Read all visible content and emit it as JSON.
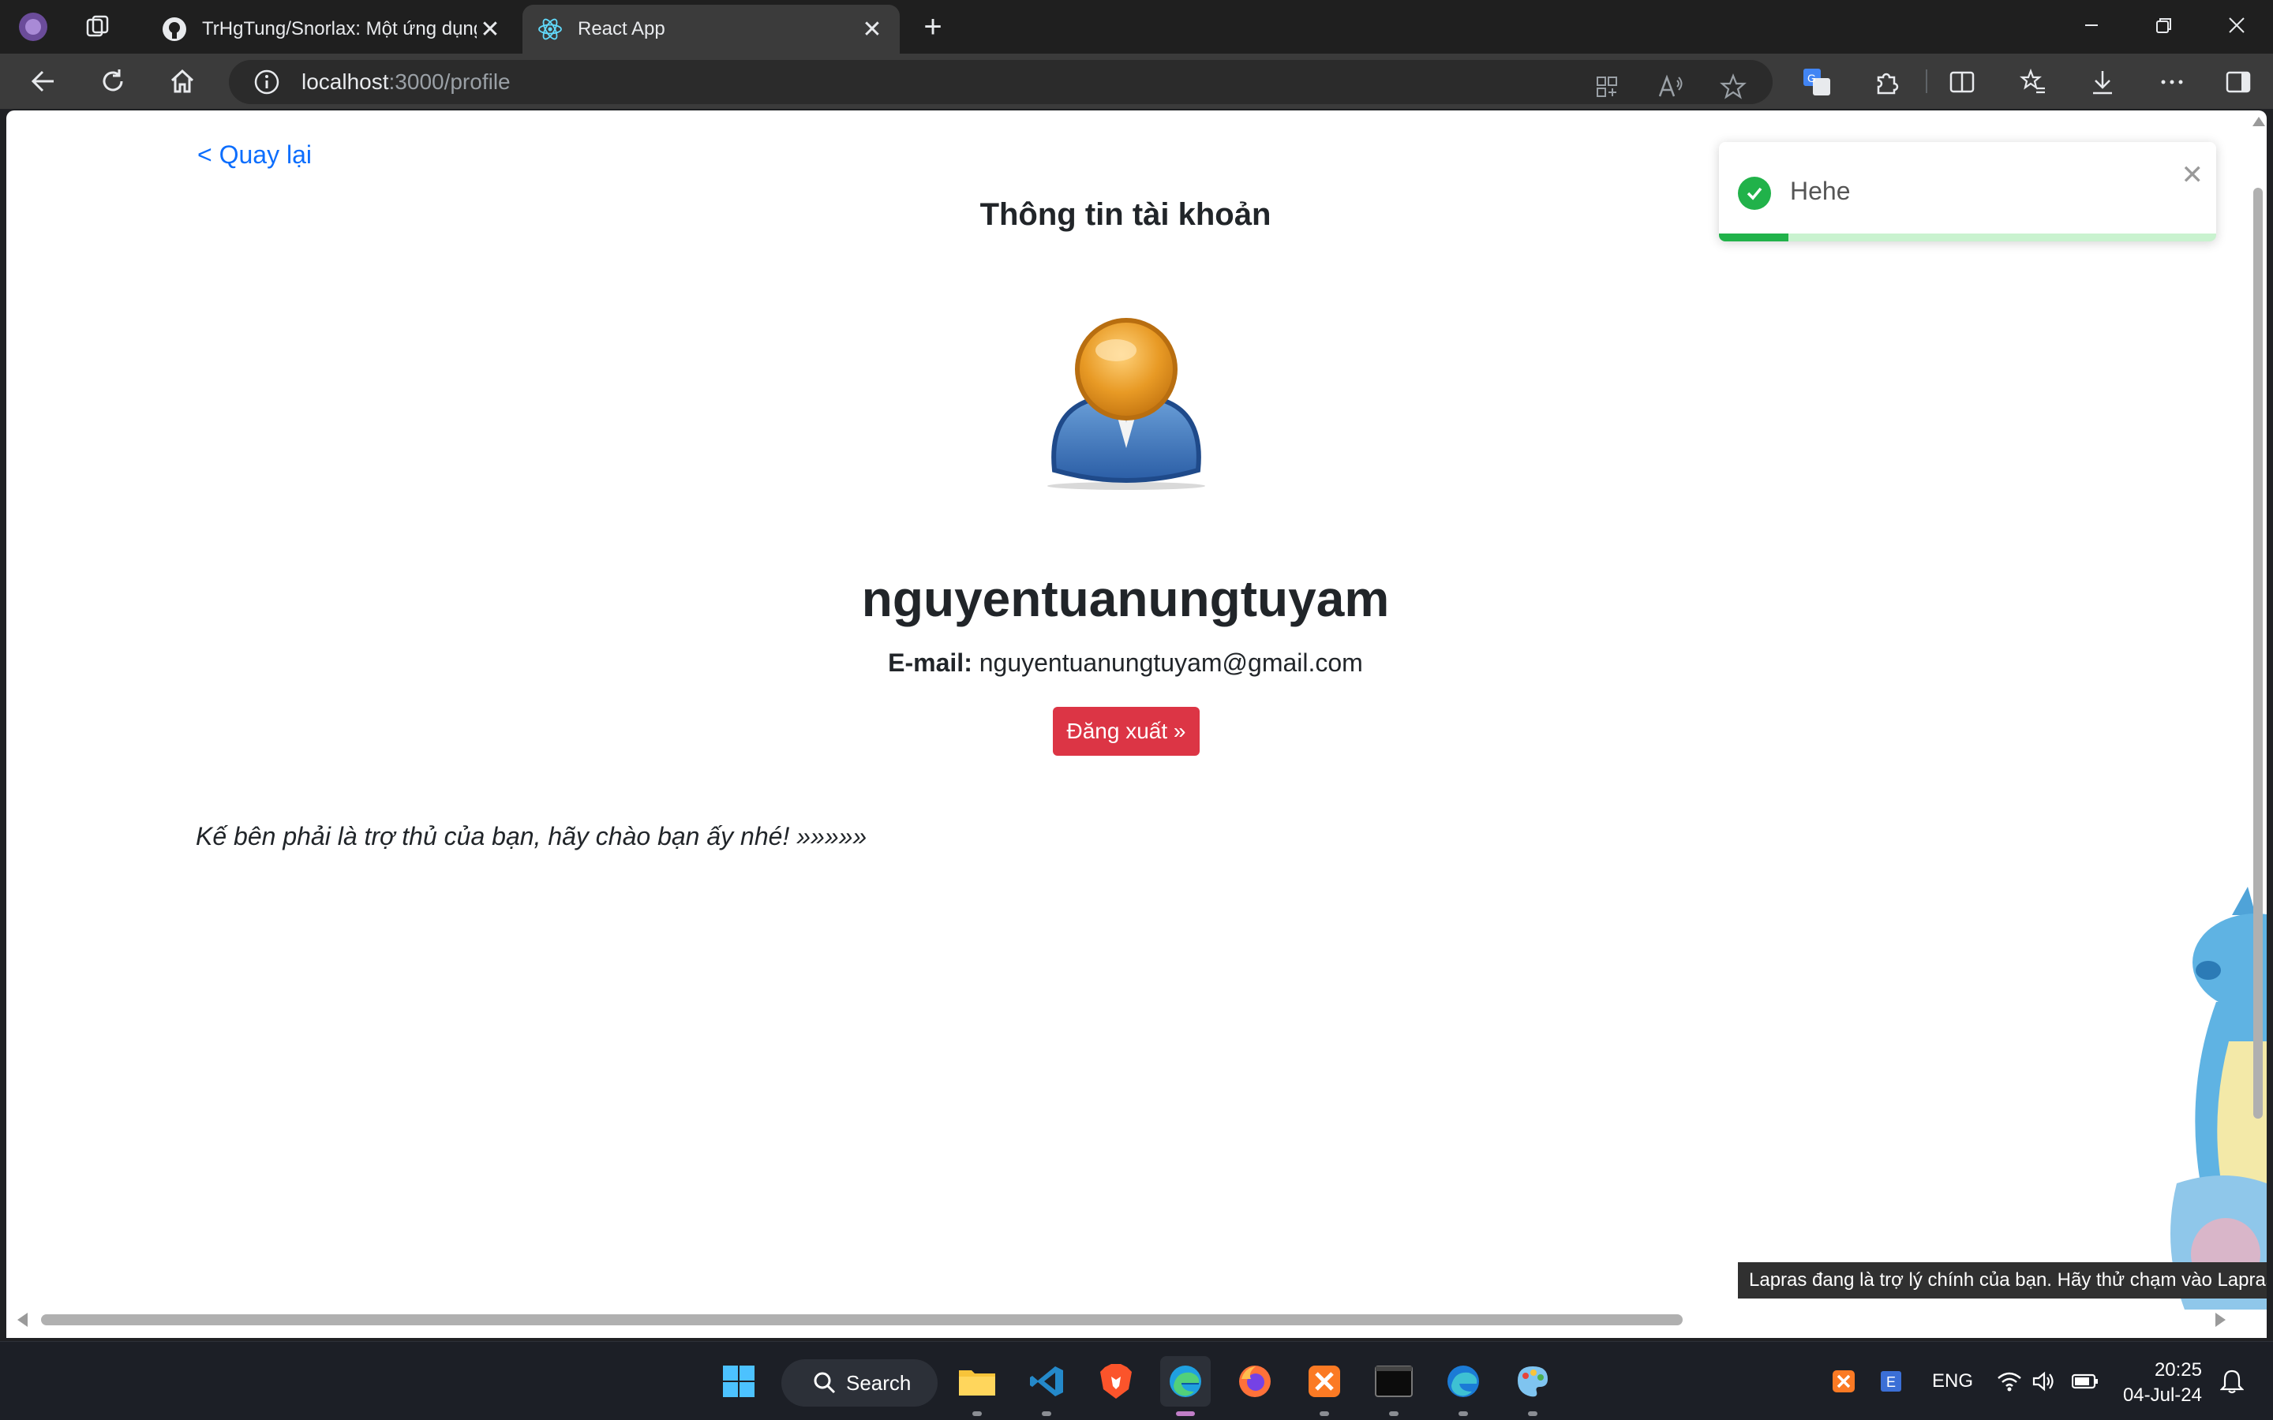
{
  "browser": {
    "tabs": [
      {
        "title": "TrHgTung/Snorlax: Một ứng dụng",
        "close": "✕"
      },
      {
        "title": "React App",
        "close": "✕"
      }
    ],
    "new_tab": "+",
    "url_host": "localhost",
    "url_path": ":3000/profile"
  },
  "page": {
    "back_link": "< Quay lại",
    "title": "Thông tin tài khoản",
    "username": "nguyentuanungtuyam",
    "email_label": "E-mail:",
    "email_value": "nguyentuanungtuyam@gmail.com",
    "logout_button": "Đăng xuất »",
    "assistant_note": "Kế bên phải là trợ thủ của bạn, hãy chào bạn ấy nhé! »»»»»"
  },
  "toast": {
    "message": "Hehe",
    "close": "✕",
    "progress": 0.14,
    "status_color": "#21b24a"
  },
  "mascot": {
    "tooltip": "Lapras đang là trợ lý chính của bạn. Hãy thử chạm vào Lapras"
  },
  "taskbar": {
    "search_label": "Search",
    "language": "ENG",
    "time": "20:25",
    "date": "04-Jul-24"
  },
  "colors": {
    "accent_link": "#0d6efd",
    "danger": "#dc3545"
  }
}
